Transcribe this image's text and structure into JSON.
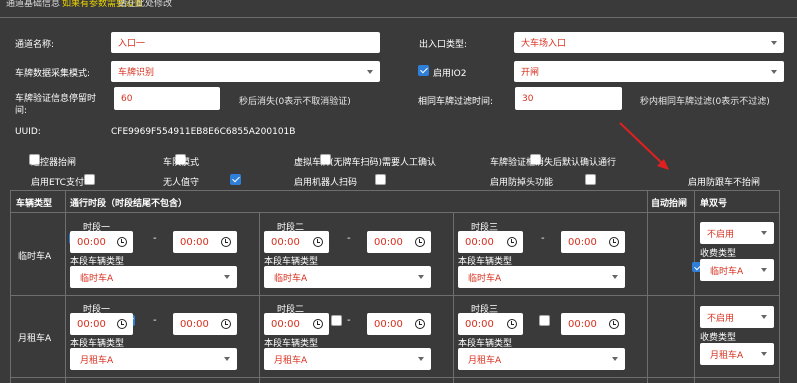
{
  "header": {
    "left_text": "通道基础信息",
    "highlight_text": "如果有参数需要设置",
    "right_text": "请在此处修改"
  },
  "form": {
    "channel_name_label": "通道名称:",
    "channel_name_value": "入口一",
    "entry_exit_label": "出入口类型:",
    "entry_exit_value": "大车场入口",
    "plate_mode_label": "车牌数据采集模式:",
    "plate_mode_value": "车牌识别",
    "io2_label": "启用IO2",
    "io2_value": "开闸",
    "stay_time_label_1": "车牌验证信息停留时",
    "stay_time_label_2": "间:",
    "stay_time_value": "60",
    "stay_time_hint": "秒后消失(0表示不取消验证)",
    "same_plate_label": "相同车牌过滤时间:",
    "same_plate_value": "30",
    "same_plate_hint": "秒内相同车牌过滤(0表示不过滤)",
    "uuid_label": "UUID:",
    "uuid_value": "CFE9969F554911EB8E6C6855A200101B"
  },
  "options": [
    {
      "label": "遥控器抬闸",
      "checked": false
    },
    {
      "label": "车队模式",
      "checked": false
    },
    {
      "label": "虚拟车牌(无牌车扫码)需要人工确认",
      "checked": false
    },
    {
      "label": "车牌验证框消失后默认确认通行",
      "checked": false
    },
    {
      "label": "启用ETC支付",
      "checked": false
    },
    {
      "label": "无人值守",
      "checked": true
    },
    {
      "label": "启用机器人扫码",
      "checked": false
    },
    {
      "label": "启用防掉头功能",
      "checked": false
    },
    {
      "label": "启用防跟车不抬闸",
      "checked": true
    }
  ],
  "table": {
    "headers": {
      "vehicle_type": "车辆类型",
      "time_period": "通行时段（时段结尾不包含）",
      "auto_lift": "自动抬闸",
      "odd_even": "单双号"
    },
    "period_labels": [
      "时段一",
      "时段二",
      "时段三"
    ],
    "time_value": "00:00",
    "dash": "-",
    "vehicle_type_label": "本段车辆类型",
    "fee_type_label": "收费类型",
    "rows": [
      {
        "name": "临时车A",
        "select_value": "临时车A",
        "odd_even_value": "不启用",
        "fee_value": "临时车A"
      },
      {
        "name": "月租车A",
        "select_value": "月租车A",
        "odd_even_value": "不启用",
        "fee_value": "月租车A"
      }
    ]
  }
}
